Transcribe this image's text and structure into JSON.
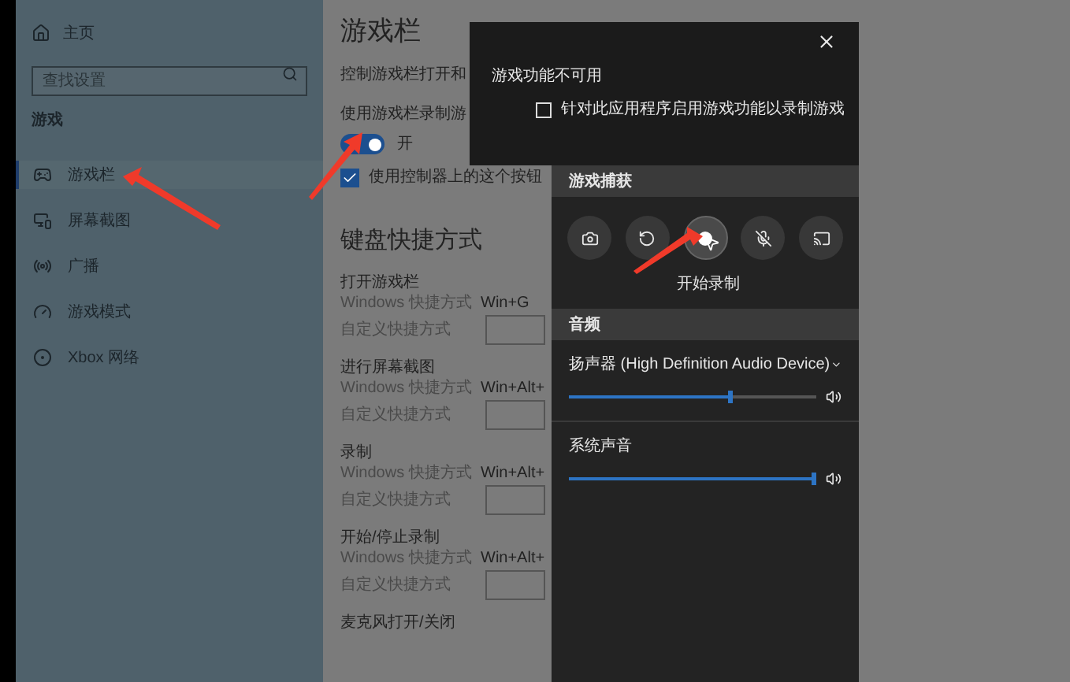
{
  "sidebar": {
    "home": "主页",
    "search_placeholder": "查找设置",
    "section": "游戏",
    "items": [
      {
        "label": "游戏栏",
        "selected": true
      },
      {
        "label": "屏幕截图",
        "selected": false
      },
      {
        "label": "广播",
        "selected": false
      },
      {
        "label": "游戏模式",
        "selected": false
      },
      {
        "label": "Xbox 网络",
        "selected": false
      }
    ]
  },
  "main": {
    "title": "游戏栏",
    "description": "控制游戏栏打开和",
    "toggle": {
      "label": "使用游戏栏录制游",
      "on": true,
      "state_text": "开"
    },
    "controller_checkbox": {
      "label": "使用控制器上的这个按钮",
      "checked": true
    },
    "shortcuts_heading": "键盘快捷方式",
    "shortcut_groups": [
      {
        "title": "打开游戏栏",
        "windows_label": "Windows 快捷方式",
        "windows_value": "Win+G",
        "custom_label": "自定义快捷方式"
      },
      {
        "title": "进行屏幕截图",
        "windows_label": "Windows 快捷方式",
        "windows_value": "Win+Alt+",
        "custom_label": "自定义快捷方式"
      },
      {
        "title": "录制",
        "windows_label": "Windows 快捷方式",
        "windows_value": "Win+Alt+",
        "custom_label": "自定义快捷方式"
      },
      {
        "title": "开始/停止录制",
        "windows_label": "Windows 快捷方式",
        "windows_value": "Win+Alt+",
        "custom_label": "自定义快捷方式"
      }
    ],
    "last_group_title": "麦克风打开/关闭"
  },
  "popup": {
    "title": "游戏功能不可用",
    "checkbox": {
      "label": "针对此应用程序启用游戏功能以录制游戏",
      "checked": false
    }
  },
  "game_bar": {
    "capture_heading": "游戏捕获",
    "buttons": [
      {
        "kind": "screenshot",
        "selected": false
      },
      {
        "kind": "replay",
        "selected": false
      },
      {
        "kind": "record",
        "selected": true
      },
      {
        "kind": "mic",
        "selected": false
      },
      {
        "kind": "broadcast",
        "selected": false
      }
    ],
    "button_label": "开始录制",
    "audio_heading": "音频",
    "channels": [
      {
        "name": "扬声器 (High Definition Audio Device)",
        "level": 0.66,
        "expandable": true
      },
      {
        "name": "系统声音",
        "level": 1,
        "expandable": false
      }
    ]
  }
}
